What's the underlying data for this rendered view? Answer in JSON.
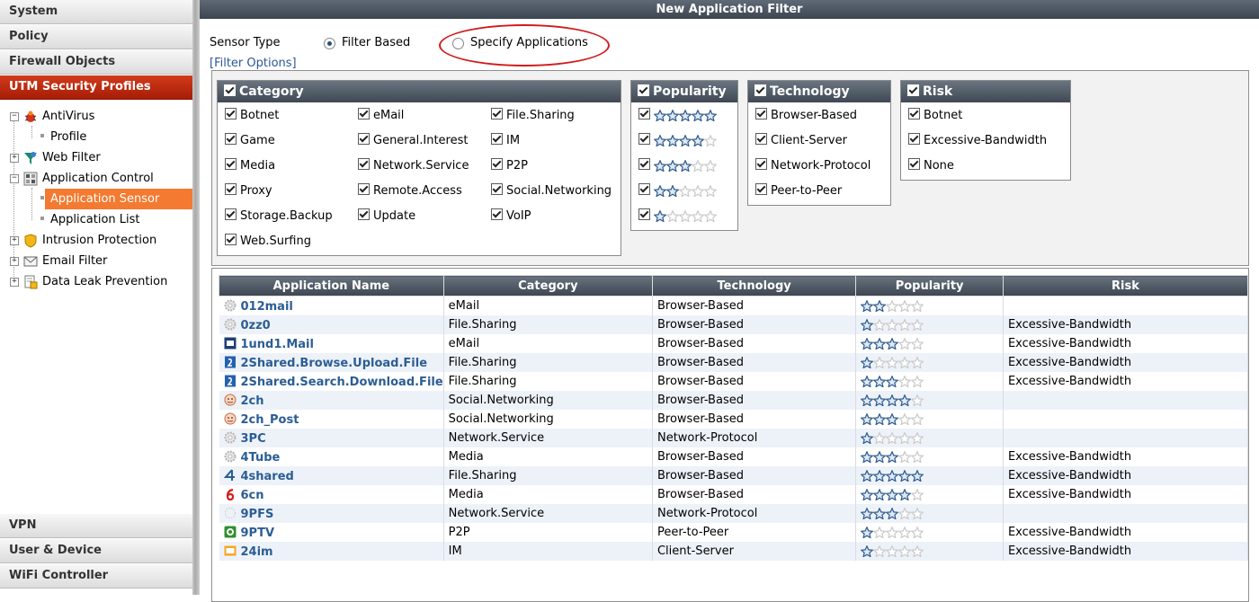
{
  "sidebar": {
    "categories": [
      {
        "label": "System"
      },
      {
        "label": "Policy"
      },
      {
        "label": "Firewall Objects"
      },
      {
        "label": "UTM Security Profiles"
      },
      {
        "label": "VPN"
      },
      {
        "label": "User & Device"
      },
      {
        "label": "WiFi Controller"
      }
    ],
    "tree": {
      "antivirus": "AntiVirus",
      "profile": "Profile",
      "web_filter": "Web Filter",
      "application_control": "Application Control",
      "application_sensor": "Application Sensor",
      "application_list": "Application List",
      "intrusion_protection": "Intrusion Protection",
      "email_filter": "Email Filter",
      "data_leak_prevention": "Data Leak Prevention"
    }
  },
  "main": {
    "title": "New Application Filter",
    "sensor_type_label": "Sensor Type",
    "radio_filter_based": "Filter Based",
    "radio_specify_apps": "Specify Applications",
    "selected_sensor_type": "Filter Based",
    "filter_options_link": "[Filter Options]"
  },
  "filters": {
    "category": {
      "title": "Category",
      "items": [
        "Botnet",
        "eMail",
        "File.Sharing",
        "Game",
        "General.Interest",
        "IM",
        "Media",
        "Network.Service",
        "P2P",
        "Proxy",
        "Remote.Access",
        "Social.Networking",
        "Storage.Backup",
        "Update",
        "VoIP",
        "Web.Surfing"
      ]
    },
    "popularity": {
      "title": "Popularity",
      "levels": [
        5,
        4,
        3,
        2,
        1
      ]
    },
    "technology": {
      "title": "Technology",
      "items": [
        "Browser-Based",
        "Client-Server",
        "Network-Protocol",
        "Peer-to-Peer"
      ]
    },
    "risk": {
      "title": "Risk",
      "items": [
        "Botnet",
        "Excessive-Bandwidth",
        "None"
      ]
    }
  },
  "table": {
    "headers": [
      "Application Name",
      "Category",
      "Technology",
      "Popularity",
      "Risk"
    ],
    "rows": [
      {
        "name": "012mail",
        "category": "eMail",
        "technology": "Browser-Based",
        "popularity": 2,
        "risk": "",
        "icon": "gear-icon"
      },
      {
        "name": "0zz0",
        "category": "File.Sharing",
        "technology": "Browser-Based",
        "popularity": 1,
        "risk": "Excessive-Bandwidth",
        "icon": "gear-icon"
      },
      {
        "name": "1und1.Mail",
        "category": "eMail",
        "technology": "Browser-Based",
        "popularity": 3,
        "risk": "Excessive-Bandwidth",
        "icon": "1und1-logo-icon"
      },
      {
        "name": "2Shared.Browse.Upload.File",
        "category": "File.Sharing",
        "technology": "Browser-Based",
        "popularity": 1,
        "risk": "Excessive-Bandwidth",
        "icon": "2shared-logo-icon"
      },
      {
        "name": "2Shared.Search.Download.File",
        "category": "File.Sharing",
        "technology": "Browser-Based",
        "popularity": 3,
        "risk": "Excessive-Bandwidth",
        "icon": "2shared-logo-icon"
      },
      {
        "name": "2ch",
        "category": "Social.Networking",
        "technology": "Browser-Based",
        "popularity": 4,
        "risk": "",
        "icon": "2ch-logo-icon"
      },
      {
        "name": "2ch_Post",
        "category": "Social.Networking",
        "technology": "Browser-Based",
        "popularity": 3,
        "risk": "",
        "icon": "2ch-logo-icon"
      },
      {
        "name": "3PC",
        "category": "Network.Service",
        "technology": "Network-Protocol",
        "popularity": 1,
        "risk": "",
        "icon": "gear-icon"
      },
      {
        "name": "4Tube",
        "category": "Media",
        "technology": "Browser-Based",
        "popularity": 3,
        "risk": "Excessive-Bandwidth",
        "icon": "gear-icon"
      },
      {
        "name": "4shared",
        "category": "File.Sharing",
        "technology": "Browser-Based",
        "popularity": 5,
        "risk": "Excessive-Bandwidth",
        "icon": "4shared-logo-icon"
      },
      {
        "name": "6cn",
        "category": "Media",
        "technology": "Browser-Based",
        "popularity": 4,
        "risk": "Excessive-Bandwidth",
        "icon": "6cn-logo-icon"
      },
      {
        "name": "9PFS",
        "category": "Network.Service",
        "technology": "Network-Protocol",
        "popularity": 3,
        "risk": "",
        "icon": "circle-icon"
      },
      {
        "name": "9PTV",
        "category": "P2P",
        "technology": "Peer-to-Peer",
        "popularity": 1,
        "risk": "Excessive-Bandwidth",
        "icon": "9ptv-logo-icon"
      },
      {
        "name": "24im",
        "category": "IM",
        "technology": "Client-Server",
        "popularity": 1,
        "risk": "Excessive-Bandwidth",
        "icon": "24im-logo-icon"
      }
    ]
  },
  "colors": {
    "active_category": "#b9270e",
    "selected_tree_item": "#f37a30",
    "header_bar": "#4a545f",
    "link": "#2b5d94",
    "star": "#2c5a8c",
    "annotation_oval": "#d11b1b"
  }
}
